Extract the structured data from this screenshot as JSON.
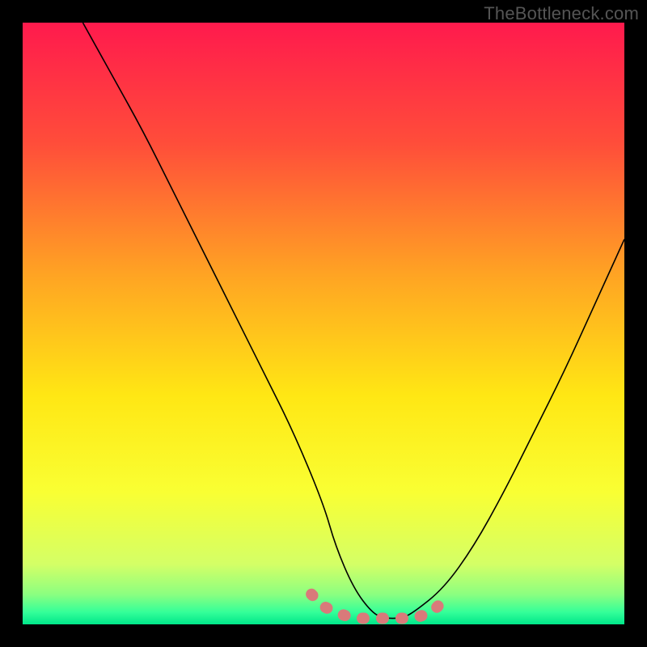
{
  "watermark": "TheBottleneck.com",
  "chart_data": {
    "type": "line",
    "title": "",
    "xlabel": "",
    "ylabel": "",
    "xlim": [
      0,
      100
    ],
    "ylim": [
      0,
      100
    ],
    "gradient_stops": [
      {
        "offset": 0,
        "color": "#ff1a4d"
      },
      {
        "offset": 20,
        "color": "#ff4d3a"
      },
      {
        "offset": 42,
        "color": "#ffa423"
      },
      {
        "offset": 62,
        "color": "#ffe714"
      },
      {
        "offset": 78,
        "color": "#f9ff33"
      },
      {
        "offset": 90,
        "color": "#d4ff66"
      },
      {
        "offset": 95,
        "color": "#8cff80"
      },
      {
        "offset": 98,
        "color": "#33ff99"
      },
      {
        "offset": 100,
        "color": "#00e68a"
      }
    ],
    "series": [
      {
        "name": "bottleneck-curve",
        "x": [
          10,
          15,
          20,
          25,
          30,
          35,
          40,
          45,
          50,
          52,
          55,
          58,
          60,
          63,
          65,
          70,
          75,
          80,
          85,
          90,
          95,
          100
        ],
        "y": [
          100,
          91,
          82,
          72,
          62,
          52,
          42,
          32,
          20,
          13,
          6,
          2,
          1,
          1,
          2,
          6,
          13,
          22,
          32,
          42,
          53,
          64
        ]
      },
      {
        "name": "highlight-band",
        "x": [
          48,
          50,
          52,
          55,
          58,
          60,
          63,
          65,
          68,
          70
        ],
        "y": [
          5,
          3,
          2,
          1,
          1,
          1,
          1,
          1,
          2,
          4
        ]
      }
    ]
  }
}
